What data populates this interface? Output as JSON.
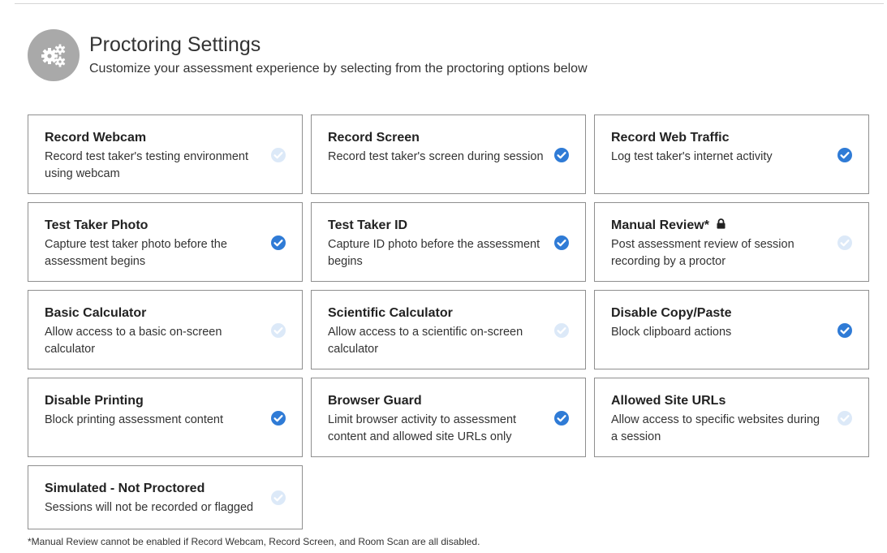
{
  "header": {
    "title": "Proctoring Settings",
    "subtitle": "Customize your assessment experience by selecting from the proctoring options below",
    "icon": "gears-icon"
  },
  "colors": {
    "accent": "#2f7bd6",
    "border": "#8f8f8f",
    "icon_bg": "#a9a9a9"
  },
  "options": [
    {
      "title": "Record Webcam",
      "description": "Record test taker's testing environment using webcam",
      "checked": false
    },
    {
      "title": "Record Screen",
      "description": "Record test taker's screen during session",
      "checked": true
    },
    {
      "title": "Record Web Traffic",
      "description": "Log test taker's internet activity",
      "checked": true
    },
    {
      "title": "Test Taker Photo",
      "description": "Capture test taker photo before the assessment begins",
      "checked": true
    },
    {
      "title": "Test Taker ID",
      "description": "Capture ID photo before the assessment begins",
      "checked": true
    },
    {
      "title": "Manual Review*",
      "description": "Post assessment review of session recording by a proctor",
      "checked": false,
      "locked": true
    },
    {
      "title": "Basic Calculator",
      "description": "Allow access to a basic on-screen calculator",
      "checked": false
    },
    {
      "title": "Scientific Calculator",
      "description": "Allow access to a scientific on-screen calculator",
      "checked": false
    },
    {
      "title": "Disable Copy/Paste",
      "description": "Block clipboard actions",
      "checked": true
    },
    {
      "title": "Disable Printing",
      "description": "Block printing assessment content",
      "checked": true
    },
    {
      "title": "Browser Guard",
      "description": "Limit browser activity to assessment content and allowed site URLs only",
      "checked": true
    },
    {
      "title": "Allowed Site URLs",
      "description": "Allow access to specific websites during a session",
      "checked": false
    },
    {
      "title": "Simulated - Not Proctored",
      "description": "Sessions will not be recorded or flagged",
      "checked": false
    }
  ],
  "footnote": "*Manual Review cannot be enabled if Record Webcam, Record Screen, and Room Scan are all disabled."
}
